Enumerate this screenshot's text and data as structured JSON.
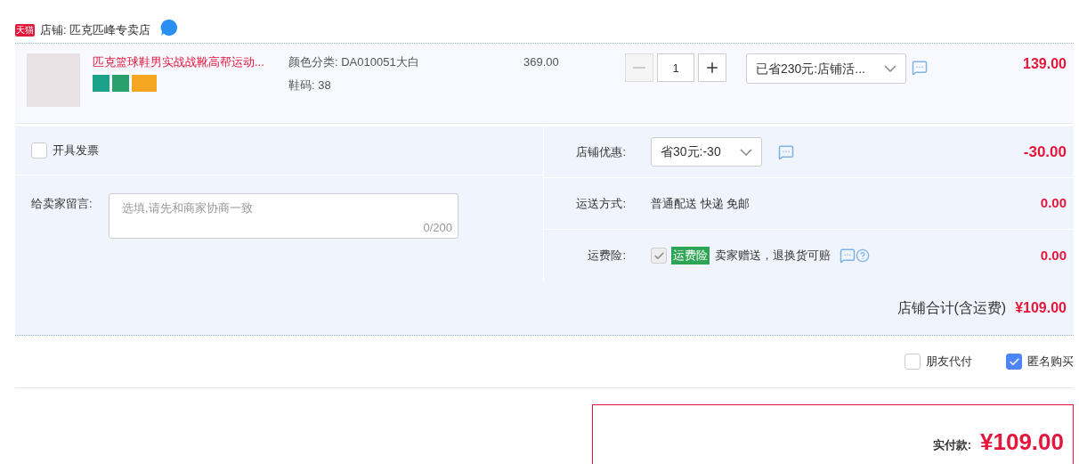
{
  "shop": {
    "badge": "天猫",
    "name": "店铺: 匹克匹峰专卖店"
  },
  "item": {
    "title": "匹克篮球鞋男实战战靴高帮运动...",
    "sku": [
      "颜色分类: DA010051大白",
      "鞋码: 38"
    ],
    "price": "369.00",
    "quantity": "1",
    "minus_disabled": true,
    "promo": "已省230元:店铺活...",
    "subtotal": "139.00"
  },
  "invoice": {
    "label": "开具发票",
    "checked": false
  },
  "message": {
    "label": "给卖家留言:",
    "placeholder": "选填,请先和商家协商一致",
    "counter": "0/200"
  },
  "rows": [
    {
      "kind": "select",
      "label": "店铺优惠:",
      "value": "省30元:-30",
      "amount": "-30.00"
    },
    {
      "kind": "text",
      "label": "运送方式:",
      "value": "普通配送 快递 免邮",
      "amount": "0.00"
    },
    {
      "kind": "insurance",
      "label": "运费险:",
      "checked": true,
      "disabled": true,
      "tag": "运费险",
      "value": "卖家赠送，退换货可赔",
      "amount": "0.00"
    }
  ],
  "total": {
    "label": "店铺合计(含运费)",
    "amount": "¥109.00"
  },
  "options": [
    {
      "label": "朋友代付",
      "checked": false
    },
    {
      "label": "匿名购买",
      "checked": true
    }
  ],
  "pay": {
    "label": "实付款:",
    "amount": "¥109.00"
  }
}
